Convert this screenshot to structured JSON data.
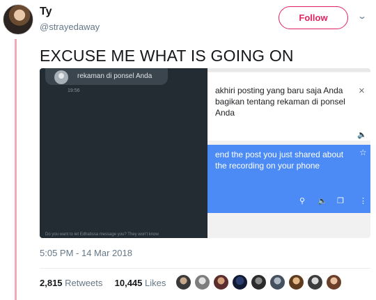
{
  "user": {
    "name": "Ty",
    "handle": "@strayedaway",
    "follow_label": "Follow",
    "menu_icon": "chevron-down-icon"
  },
  "tweet": {
    "text": "EXCUSE ME WHAT IS GOING ON",
    "timestamp": "5:05 PM - 14 Mar 2018"
  },
  "media": {
    "chat": {
      "bubble_text": "rekaman di ponsel Anda",
      "time": "19:56",
      "footer_text": "Do you want to let Edhatissa message you? They won't know"
    },
    "translate": {
      "source_text": "akhiri posting yang baru saja Anda bagikan tentang rekaman di ponsel Anda",
      "result_text": "end the post you just shared about the recording on your phone",
      "icons": [
        "close-icon",
        "speaker-icon",
        "star-icon",
        "search-icon",
        "copy-icon",
        "more-icon"
      ]
    }
  },
  "stats": {
    "retweets_count": "2,815",
    "retweets_label": "Retweets",
    "likes_count": "10,445",
    "likes_label": "Likes"
  },
  "colors": {
    "accent": "#e0245e",
    "thread_rail": "#f3a7b9",
    "translate_blue": "#4c8bf5",
    "chat_bg": "#232b33"
  }
}
